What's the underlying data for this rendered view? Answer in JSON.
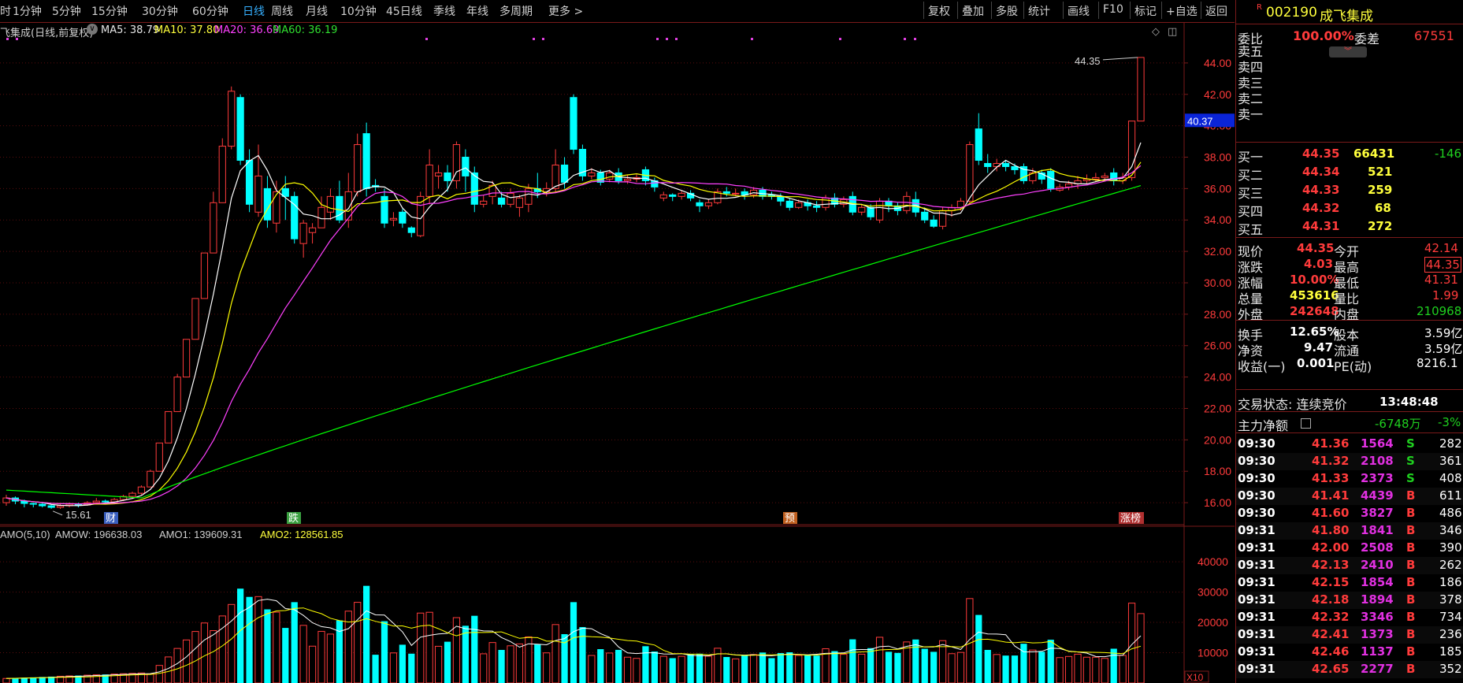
{
  "toolbar": {
    "periods": [
      "时",
      "1分钟",
      "5分钟",
      "15分钟",
      "30分钟",
      "60分钟",
      "日线",
      "周线",
      "月线",
      "10分钟",
      "45日线",
      "季线",
      "年线",
      "多周期",
      "更多 >"
    ],
    "active_period": "日线",
    "right_buttons": [
      "复权",
      "叠加",
      "多股",
      "统计",
      "画线",
      "F10",
      "标记",
      "+自选",
      "返回"
    ]
  },
  "header": {
    "title": "飞集成(日线,前复权)",
    "ma5": "MA5: 38.79",
    "ma10": "MA10: 37.80",
    "ma20": "MA20: 36.69",
    "ma60": "MA60: 36.19",
    "colors": {
      "ma5": "#ffffff",
      "ma10": "#ffff00",
      "ma20": "#ff40ff",
      "ma60": "#00ff00",
      "up": "#ff3b3b",
      "down": "#00ffff"
    }
  },
  "volume_header": {
    "amo": "AMO(5,10)",
    "amow": "AMOW: 196638.03",
    "amo1": "AMO1: 139609.31",
    "amo2": "AMO2: 128561.85",
    "unit_label": "X10"
  },
  "chart_data": [
    {
      "type": "candlestick",
      "title": "飞集成(日线,前复权)",
      "yticks": [
        "16.00",
        "18.00",
        "20.00",
        "22.00",
        "24.00",
        "26.00",
        "28.00",
        "30.00",
        "32.00",
        "34.00",
        "36.00",
        "38.00",
        "40.00",
        "42.00",
        "44.00"
      ],
      "ylim": [
        14.9,
        45.5
      ],
      "current_price_label": "40.37",
      "high_annotation": "44.35",
      "low_annotation": "15.61",
      "event_markers": [
        "财",
        "跌",
        "预",
        "涨榜"
      ],
      "candles": [
        [
          16.0,
          16.3,
          15.8,
          16.5
        ],
        [
          16.3,
          16.1,
          15.9,
          16.4
        ],
        [
          16.1,
          15.95,
          15.7,
          16.2
        ],
        [
          15.95,
          15.9,
          15.7,
          16.0
        ],
        [
          15.9,
          15.8,
          15.7,
          16.0
        ],
        [
          15.8,
          15.7,
          15.61,
          15.9
        ],
        [
          15.7,
          15.8,
          15.6,
          15.9
        ],
        [
          15.8,
          15.9,
          15.7,
          16.0
        ],
        [
          15.9,
          15.85,
          15.7,
          16.0
        ],
        [
          15.85,
          16.0,
          15.8,
          16.1
        ],
        [
          16.0,
          16.1,
          15.9,
          16.3
        ],
        [
          16.1,
          16.05,
          15.9,
          16.2
        ],
        [
          16.05,
          16.2,
          16.0,
          16.3
        ],
        [
          16.2,
          16.4,
          16.1,
          16.5
        ],
        [
          16.4,
          16.6,
          16.3,
          16.7
        ],
        [
          16.6,
          17.0,
          16.5,
          17.1
        ],
        [
          17.0,
          18.0,
          17.0,
          18.1
        ],
        [
          18.0,
          19.8,
          19.8,
          19.8
        ],
        [
          19.8,
          21.8,
          21.8,
          21.8
        ],
        [
          21.8,
          24.0,
          21.8,
          24.2
        ],
        [
          24.0,
          26.4,
          26.4,
          26.4
        ],
        [
          26.4,
          29.0,
          29.0,
          29.0
        ],
        [
          29.0,
          31.9,
          31.9,
          31.9
        ],
        [
          31.9,
          35.1,
          34.8,
          35.8
        ],
        [
          35.1,
          38.7,
          36.8,
          39.2
        ],
        [
          38.7,
          42.2,
          38.5,
          42.5
        ],
        [
          41.8,
          37.8,
          37.5,
          42.0
        ],
        [
          37.8,
          35.0,
          34.5,
          38.5
        ],
        [
          34.5,
          36.8,
          34.2,
          38.8
        ],
        [
          36.0,
          34.0,
          33.5,
          36.8
        ],
        [
          33.8,
          35.8,
          33.2,
          36.5
        ],
        [
          36.0,
          35.5,
          34.0,
          36.8
        ],
        [
          35.5,
          32.8,
          32.5,
          35.8
        ],
        [
          32.5,
          33.8,
          31.6,
          34.0
        ],
        [
          33.2,
          33.5,
          32.5,
          33.8
        ],
        [
          33.5,
          34.8,
          33.5,
          35.5
        ],
        [
          34.5,
          35.5,
          34.0,
          36.0
        ],
        [
          35.5,
          34.0,
          33.8,
          36.5
        ],
        [
          34.0,
          35.8,
          33.5,
          37.0
        ],
        [
          35.8,
          38.8,
          35.5,
          39.5
        ],
        [
          39.5,
          36.0,
          35.5,
          40.2
        ],
        [
          36.2,
          36.1,
          35.8,
          36.6
        ],
        [
          35.5,
          33.8,
          33.5,
          36.0
        ],
        [
          34.0,
          34.1,
          33.6,
          34.5
        ],
        [
          34.5,
          33.8,
          33.5,
          34.7
        ],
        [
          33.5,
          33.2,
          32.9,
          33.6
        ],
        [
          33.0,
          35.5,
          32.9,
          35.8
        ],
        [
          35.5,
          37.5,
          35.0,
          38.5
        ],
        [
          36.8,
          37.0,
          36.0,
          37.5
        ],
        [
          37.0,
          36.5,
          35.8,
          37.5
        ],
        [
          36.5,
          38.8,
          36.0,
          39.0
        ],
        [
          38.0,
          36.8,
          35.8,
          38.5
        ],
        [
          37.0,
          35.0,
          34.5,
          37.4
        ],
        [
          35.0,
          35.2,
          34.8,
          35.6
        ],
        [
          35.5,
          36.2,
          35.0,
          36.5
        ],
        [
          35.4,
          35.0,
          34.8,
          35.8
        ],
        [
          35.0,
          35.7,
          34.8,
          36.0
        ],
        [
          34.8,
          35.4,
          34.2,
          35.6
        ],
        [
          35.0,
          36.0,
          34.5,
          36.3
        ],
        [
          36.0,
          35.8,
          35.4,
          37.0
        ],
        [
          35.8,
          36.0,
          35.5,
          36.4
        ],
        [
          36.0,
          37.5,
          35.8,
          38.5
        ],
        [
          37.5,
          36.4,
          36.0,
          38.0
        ],
        [
          41.8,
          38.5,
          38.2,
          42.0
        ],
        [
          38.5,
          36.8,
          36.5,
          38.8
        ],
        [
          36.8,
          37.0,
          36.6,
          37.3
        ],
        [
          37.0,
          36.4,
          36.2,
          37.2
        ],
        [
          36.6,
          37.0,
          36.4,
          37.2
        ],
        [
          37.0,
          36.5,
          36.3,
          37.3
        ],
        [
          36.5,
          36.6,
          36.3,
          36.9
        ],
        [
          36.6,
          36.7,
          36.4,
          36.9
        ],
        [
          37.2,
          36.5,
          36.2,
          37.4
        ],
        [
          36.5,
          36.1,
          35.8,
          36.7
        ],
        [
          35.4,
          35.6,
          35.2,
          35.8
        ],
        [
          35.6,
          35.5,
          35.2,
          35.7
        ],
        [
          35.5,
          35.7,
          35.3,
          35.9
        ],
        [
          35.7,
          35.4,
          35.2,
          35.9
        ],
        [
          35.1,
          34.9,
          34.5,
          35.3
        ],
        [
          34.9,
          35.1,
          34.7,
          35.3
        ],
        [
          35.1,
          35.8,
          35.0,
          36.0
        ],
        [
          35.8,
          35.7,
          35.5,
          36.1
        ],
        [
          35.7,
          35.7,
          35.5,
          36.0
        ],
        [
          35.8,
          35.6,
          35.3,
          36.0
        ],
        [
          35.6,
          35.9,
          35.4,
          36.1
        ],
        [
          35.9,
          35.5,
          35.3,
          36.1
        ],
        [
          35.6,
          35.5,
          35.3,
          35.8
        ],
        [
          35.5,
          35.2,
          34.9,
          35.7
        ],
        [
          35.2,
          34.8,
          34.6,
          35.4
        ],
        [
          34.8,
          35.1,
          34.7,
          35.3
        ],
        [
          35.1,
          34.9,
          34.6,
          35.3
        ],
        [
          34.9,
          34.8,
          34.5,
          35.2
        ],
        [
          34.8,
          35.4,
          34.6,
          35.6
        ],
        [
          35.4,
          35.0,
          34.8,
          35.7
        ],
        [
          35.0,
          35.3,
          34.8,
          35.5
        ],
        [
          35.5,
          34.5,
          34.3,
          35.8
        ],
        [
          34.5,
          34.8,
          34.3,
          35.0
        ],
        [
          34.8,
          34.2,
          34.0,
          35.0
        ],
        [
          34.0,
          35.2,
          33.8,
          35.4
        ],
        [
          35.2,
          34.9,
          34.5,
          35.4
        ],
        [
          34.9,
          34.6,
          34.3,
          35.1
        ],
        [
          34.6,
          35.5,
          34.4,
          35.8
        ],
        [
          35.3,
          34.5,
          34.2,
          35.8
        ],
        [
          34.5,
          34.0,
          33.8,
          34.8
        ],
        [
          34.0,
          33.6,
          33.5,
          34.3
        ],
        [
          33.6,
          34.6,
          33.4,
          34.8
        ],
        [
          34.6,
          34.8,
          34.2,
          35.0
        ],
        [
          34.8,
          35.2,
          34.6,
          35.4
        ],
        [
          35.2,
          38.8,
          35.0,
          39.0
        ],
        [
          39.8,
          37.8,
          37.5,
          40.8
        ],
        [
          37.6,
          37.4,
          37.0,
          38.2
        ],
        [
          37.4,
          37.6,
          37.1,
          37.9
        ],
        [
          37.6,
          37.4,
          37.1,
          37.8
        ],
        [
          37.4,
          37.2,
          36.9,
          37.6
        ],
        [
          37.4,
          36.5,
          36.3,
          37.6
        ],
        [
          36.5,
          37.0,
          36.3,
          37.3
        ],
        [
          37.0,
          36.6,
          36.3,
          37.2
        ],
        [
          37.1,
          36.0,
          35.8,
          37.3
        ],
        [
          35.9,
          36.1,
          35.8,
          36.3
        ],
        [
          36.1,
          36.3,
          35.9,
          36.5
        ],
        [
          36.3,
          36.5,
          36.0,
          36.8
        ],
        [
          36.5,
          36.6,
          36.3,
          36.9
        ],
        [
          36.6,
          36.7,
          36.4,
          37.0
        ],
        [
          36.7,
          36.8,
          36.5,
          37.0
        ],
        [
          37.0,
          36.5,
          36.2,
          37.3
        ],
        [
          36.5,
          36.7,
          36.3,
          37.0
        ],
        [
          36.7,
          40.3,
          36.5,
          40.3
        ],
        [
          40.3,
          44.35,
          41.31,
          44.35
        ]
      ],
      "ma60_endpoints": {
        "start": 16.8,
        "end": 36.19
      }
    },
    {
      "type": "bar",
      "title": "AMO(5,10)",
      "yticks": [
        "10000",
        "20000",
        "30000",
        "40000"
      ],
      "ylim": [
        0,
        46000
      ]
    }
  ],
  "quote": {
    "code": "002190",
    "name": "成飞集成",
    "weibi_label": "委比",
    "weibi": "100.00%",
    "weicha_label": "委差",
    "weicha": "67551",
    "sell_labels": [
      "卖五",
      "卖四",
      "卖三",
      "卖二",
      "卖一"
    ],
    "buys": [
      {
        "label": "买一",
        "price": "44.35",
        "vol": "66431",
        "chg": "-146"
      },
      {
        "label": "买二",
        "price": "44.34",
        "vol": "521",
        "chg": ""
      },
      {
        "label": "买三",
        "price": "44.33",
        "vol": "259",
        "chg": ""
      },
      {
        "label": "买四",
        "price": "44.32",
        "vol": "68",
        "chg": ""
      },
      {
        "label": "买五",
        "price": "44.31",
        "vol": "272",
        "chg": ""
      }
    ],
    "stats": [
      {
        "l1": "现价",
        "v1": "44.35",
        "l2": "今开",
        "v2": "42.14"
      },
      {
        "l1": "涨跌",
        "v1": "4.03",
        "l2": "最高",
        "v2": "44.35"
      },
      {
        "l1": "涨幅",
        "v1": "10.00%",
        "l2": "最低",
        "v2": "41.31"
      },
      {
        "l1": "总量",
        "v1": "453616",
        "l2": "量比",
        "v2": "1.99"
      },
      {
        "l1": "外盘",
        "v1": "242648",
        "l2": "内盘",
        "v2": "210968"
      },
      {
        "l1": "换手",
        "v1": "12.65%",
        "l2": "股本",
        "v2": "3.59亿"
      },
      {
        "l1": "净资",
        "v1": "9.47",
        "l2": "流通",
        "v2": "3.59亿"
      },
      {
        "l1": "收益(一)",
        "v1": "0.001",
        "l2": "PE(动)",
        "v2": "8216.1"
      }
    ],
    "trade_status": "交易状态: 连续竞价",
    "trade_time": "13:48:48",
    "main_force_label": "主力净额",
    "main_force_value": "-6748万",
    "main_force_pct": "-3%",
    "ticks": [
      {
        "t": "09:30",
        "p": "41.36",
        "v": "1564",
        "s": "S",
        "n": "282"
      },
      {
        "t": "09:30",
        "p": "41.32",
        "v": "2108",
        "s": "S",
        "n": "361"
      },
      {
        "t": "09:30",
        "p": "41.33",
        "v": "2373",
        "s": "S",
        "n": "408"
      },
      {
        "t": "09:30",
        "p": "41.41",
        "v": "4439",
        "s": "B",
        "n": "611"
      },
      {
        "t": "09:30",
        "p": "41.60",
        "v": "3827",
        "s": "B",
        "n": "486"
      },
      {
        "t": "09:31",
        "p": "41.80",
        "v": "1841",
        "s": "B",
        "n": "346"
      },
      {
        "t": "09:31",
        "p": "42.00",
        "v": "2508",
        "s": "B",
        "n": "390"
      },
      {
        "t": "09:31",
        "p": "42.13",
        "v": "2410",
        "s": "B",
        "n": "262"
      },
      {
        "t": "09:31",
        "p": "42.15",
        "v": "1854",
        "s": "B",
        "n": "186"
      },
      {
        "t": "09:31",
        "p": "42.18",
        "v": "1894",
        "s": "B",
        "n": "378"
      },
      {
        "t": "09:31",
        "p": "42.32",
        "v": "3346",
        "s": "B",
        "n": "734"
      },
      {
        "t": "09:31",
        "p": "42.41",
        "v": "1373",
        "s": "B",
        "n": "236"
      },
      {
        "t": "09:31",
        "p": "42.46",
        "v": "1137",
        "s": "B",
        "n": "185"
      },
      {
        "t": "09:31",
        "p": "42.65",
        "v": "2277",
        "s": "B",
        "n": "352"
      }
    ]
  }
}
